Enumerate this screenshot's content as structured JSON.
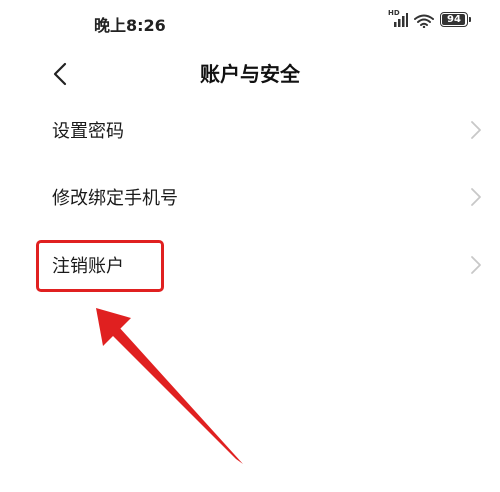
{
  "status_bar": {
    "time": "晚上8:26",
    "network_label": "HD",
    "battery": "94",
    "battery_level": 0.94
  },
  "header": {
    "back_icon": "chevron-left-icon",
    "title": "账户与安全"
  },
  "menu": {
    "items": [
      {
        "label": "设置密码",
        "icon": "chevron-right-icon"
      },
      {
        "label": "修改绑定手机号",
        "icon": "chevron-right-icon"
      },
      {
        "label": "注销账户",
        "icon": "chevron-right-icon"
      }
    ]
  },
  "colors": {
    "annotation": "#e02020",
    "chevron": "#c8c8c8",
    "text": "#1a1a1a"
  }
}
